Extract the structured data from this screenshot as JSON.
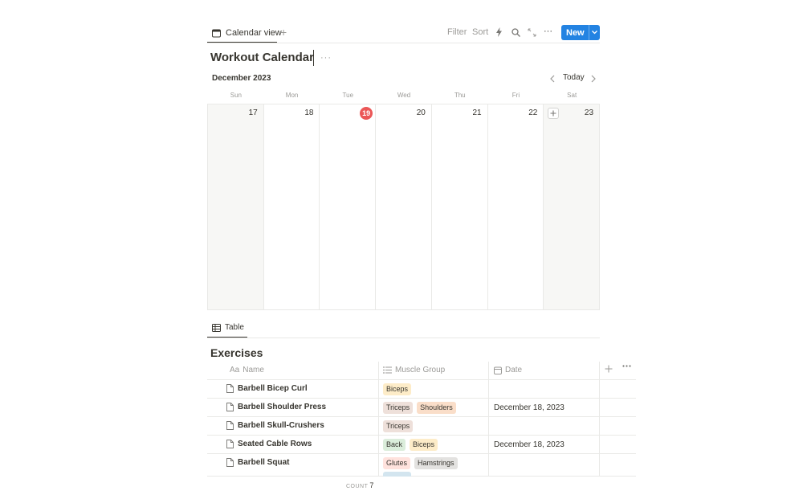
{
  "toolbar": {
    "view_tab": "Calendar view",
    "add_view": "+",
    "filter": "Filter",
    "sort": "Sort",
    "more": "···",
    "new_label": "New"
  },
  "page": {
    "title": "Workout Calendar",
    "more": "···"
  },
  "calendar": {
    "month": "December 2023",
    "today_label": "Today",
    "weekdays": [
      "Sun",
      "Mon",
      "Tue",
      "Wed",
      "Thu",
      "Fri",
      "Sat"
    ],
    "days": [
      "17",
      "18",
      "19",
      "20",
      "21",
      "22",
      "23"
    ],
    "today_day": "19",
    "today_color": "#eb5757"
  },
  "table_tab": {
    "label": "Table"
  },
  "table": {
    "title": "Exercises",
    "columns": {
      "name": "Name",
      "name_prefix": "Aa",
      "muscle_group": "Muscle Group",
      "date": "Date"
    },
    "rows": [
      {
        "name": "Barbell Bicep Curl",
        "tags": [
          "Biceps"
        ],
        "date": ""
      },
      {
        "name": "Barbell Shoulder Press",
        "tags": [
          "Triceps",
          "Shoulders"
        ],
        "date": "December 18, 2023"
      },
      {
        "name": "Barbell Skull-Crushers",
        "tags": [
          "Triceps"
        ],
        "date": ""
      },
      {
        "name": "Seated Cable Rows",
        "tags": [
          "Back",
          "Biceps"
        ],
        "date": "December 18, 2023"
      },
      {
        "name": "Barbell Squat",
        "tags": [
          "Glutes",
          "Hamstrings"
        ],
        "date": ""
      }
    ],
    "count_label": "COUNT",
    "count_value": "7"
  },
  "colors": {
    "accent": "#2383e2",
    "tag_biceps": "#fdecc8",
    "tag_triceps": "#eee0da",
    "tag_shoulders": "#fadec9",
    "tag_back": "#dbeddb",
    "tag_glutes": "#ffe2dd",
    "tag_hamstrings": "#e3e2e0"
  }
}
